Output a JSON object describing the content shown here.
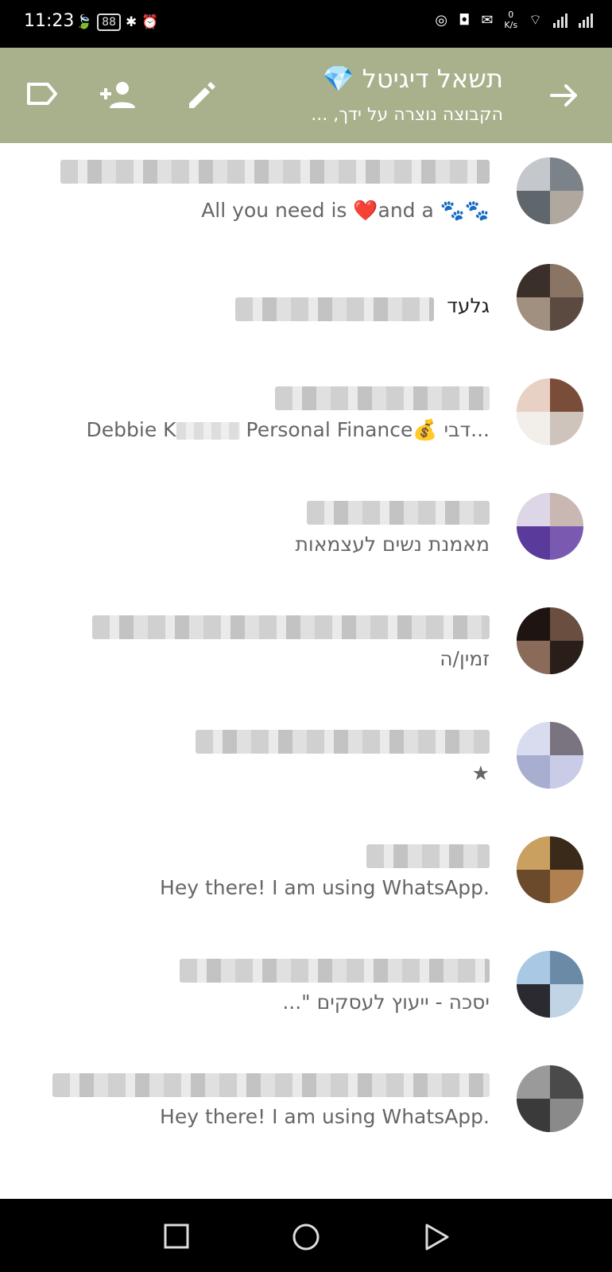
{
  "status_bar": {
    "time": "11:23",
    "battery": "88",
    "net_speed_value": "0",
    "net_speed_unit": "K/s"
  },
  "header": {
    "title": "תשאל דיגיטל 💎",
    "subtitle": "הקבוצה נוצרה על ידך, ..."
  },
  "contacts": [
    {
      "name": "",
      "about": "All you need is ❤️and a 🐾🐾"
    },
    {
      "name": "גלעד",
      "about": ""
    },
    {
      "name": "",
      "about_before": "Debbie K",
      "about_after": " Personal Finance💰 דבי..."
    },
    {
      "name": "",
      "about": "מאמנת נשים לעצמאות"
    },
    {
      "name": "",
      "about": "זמין/ה"
    },
    {
      "name": "",
      "about": "★"
    },
    {
      "name": "",
      "about": "Hey there! I am using WhatsApp."
    },
    {
      "name": "",
      "about": "יסכה - ייעוץ לעסקים \"..."
    },
    {
      "name": "",
      "about": "Hey there! I am using WhatsApp."
    }
  ],
  "icons": {
    "label": "label-icon",
    "add_person": "add-person-icon",
    "edit": "edit-icon",
    "forward": "forward-arrow-icon"
  },
  "colors": {
    "appbar": "#a8b08c",
    "status_bar": "#000000"
  }
}
